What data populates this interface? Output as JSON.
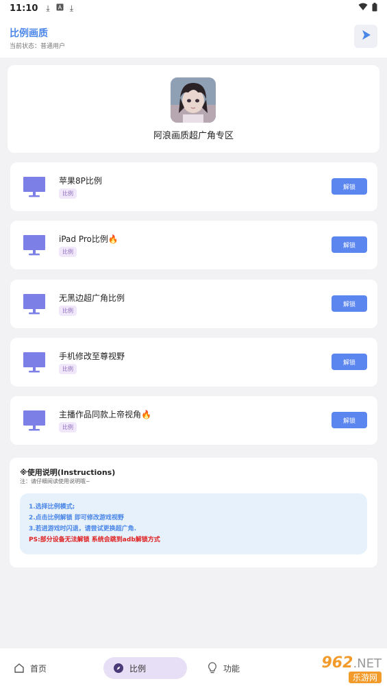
{
  "status_bar": {
    "time": "11:10",
    "icons": [
      "download-icon",
      "a-icon",
      "download-icon",
      "wifi-icon",
      "battery-icon"
    ]
  },
  "app_bar": {
    "title": "比例画质",
    "subtitle": "当前状态：普通用户",
    "action_icon": "play-icon"
  },
  "hero": {
    "title": "阿浪画质超广角专区"
  },
  "items": [
    {
      "title": "苹果8P比例",
      "tag": "比例",
      "button": "解锁"
    },
    {
      "title": "iPad Pro比例",
      "tag": "比例",
      "button": "解锁",
      "flame": "🔥"
    },
    {
      "title": "无黑边超广角比例",
      "tag": "比例",
      "button": "解锁"
    },
    {
      "title": "手机修改至尊视野",
      "tag": "比例",
      "button": "解锁"
    },
    {
      "title": "主播作品同款上帝视角",
      "tag": "比例",
      "button": "解锁",
      "flame": "🔥"
    }
  ],
  "instructions": {
    "title": "※使用说明(Instructions)",
    "note": "注：请仔细阅读使用说明哦~",
    "lines": [
      "1.选择比例模式;",
      "2.点击比例解锁 即可修改游戏视野",
      "3.若进游戏时闪退，请尝试更换超广角."
    ],
    "warning": "PS:部分设备无法解锁 系统会跳到adb解锁方式"
  },
  "bottom_nav": {
    "items": [
      {
        "label": "首页",
        "icon": "home-icon"
      },
      {
        "label": "比例",
        "icon": "compass-icon",
        "active": true
      },
      {
        "label": "功能",
        "icon": "lightbulb-icon"
      }
    ]
  },
  "watermark": {
    "number": "962",
    "suffix": ".NET",
    "text": "乐游网"
  },
  "colors": {
    "accent": "#4a86e8",
    "button": "#5b86f0",
    "monitor": "#7b7fe6",
    "tag_bg": "#f0e8fa",
    "warning": "#e02020"
  }
}
